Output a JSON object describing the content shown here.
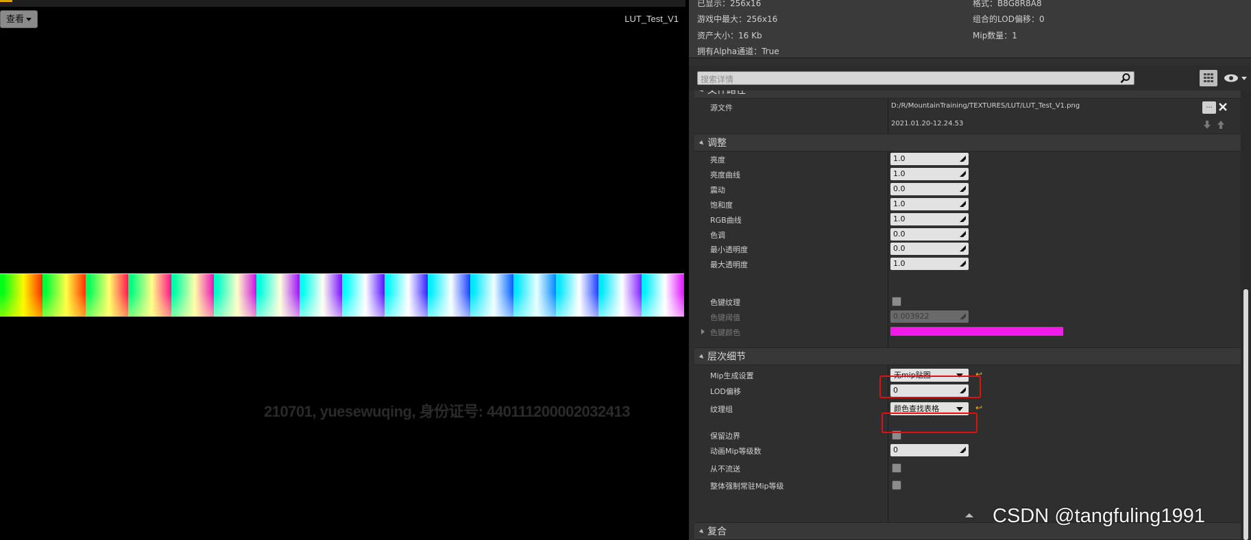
{
  "viewport": {
    "view_button": "查看",
    "asset_name": "LUT_Test_V1",
    "watermark": "210701, yuesewuqing, 身份证号: 440111200002032413",
    "lut_tiles": [
      [
        "#ff2a00",
        "#00ff18",
        "#fbf900",
        "#ff3a00"
      ],
      [
        "#ff3000",
        "#00ff38",
        "#ffff45",
        "#ff2e00"
      ],
      [
        "#ff1850",
        "#00ff5a",
        "#ffff6a",
        "#ff2060"
      ],
      [
        "#ff1088",
        "#00ff80",
        "#ffff88",
        "#ff1090"
      ],
      [
        "#ee10b8",
        "#00ffa8",
        "#ffffa8",
        "#ee10c0"
      ],
      [
        "#cc10e0",
        "#00ffc8",
        "#ffffc8",
        "#cc10e8"
      ],
      [
        "#a010f8",
        "#00ffe0",
        "#ffffdd",
        "#a010ff"
      ],
      [
        "#7810ff",
        "#00fff0",
        "#fffff0",
        "#7810ff"
      ],
      [
        "#5510ff",
        "#00ffff",
        "#ffffff",
        "#5510ff"
      ],
      [
        "#3520ff",
        "#00f8ff",
        "#ffffff",
        "#3a20ff"
      ],
      [
        "#1a40ff",
        "#00f0ff",
        "#f8ffff",
        "#2040ff"
      ],
      [
        "#0060ff",
        "#00e8ff",
        "#f0ffff",
        "#0060ff"
      ],
      [
        "#0088ff",
        "#00e8ff",
        "#e8ffff",
        "#3050ff"
      ],
      [
        "#2040ff",
        "#00e8ff",
        "#ffffff",
        "#8030ff"
      ],
      [
        "#8020ff",
        "#00e8ff",
        "#ffffff",
        "#d020ff"
      ],
      [
        "#e010ff",
        "#00f0ff",
        "#ffffff",
        "#ff10ff"
      ]
    ]
  },
  "info": {
    "displayed": "已显示：256x16",
    "format": "格式：B8G8R8A8",
    "max_ingame": "游戏中最大：256x16",
    "combined_lod": "组合的LOD偏移：0",
    "resource_size": "资产大小：16 Kb",
    "mip_count": "Mip数量：1",
    "has_alpha": "拥有Alpha通道：True"
  },
  "search": {
    "placeholder": "搜索详情"
  },
  "file_path": {
    "category": "文件路径",
    "source_label": "源文件",
    "source_value": "D:/R/MountainTraining/TEXTURES/LUT/LUT_Test_V1.png",
    "timestamp": "2021.01.20-12.24.53",
    "browse_label": "..."
  },
  "adjust": {
    "category": "调整",
    "rows": [
      {
        "label": "亮度",
        "value": "1.0"
      },
      {
        "label": "亮度曲线",
        "value": "1.0"
      },
      {
        "label": "震动",
        "value": "0.0"
      },
      {
        "label": "饱和度",
        "value": "1.0"
      },
      {
        "label": "RGB曲线",
        "value": "1.0"
      },
      {
        "label": "色调",
        "value": "0.0"
      },
      {
        "label": "最小透明度",
        "value": "0.0"
      },
      {
        "label": "最大透明度",
        "value": "1.0"
      }
    ],
    "chroma_key_label": "色键纹理",
    "chroma_threshold_label": "色键阈值",
    "chroma_threshold_value": "0.003922",
    "chroma_color_label": "色键颜色",
    "chroma_color": "#ee1bea"
  },
  "lod": {
    "category": "层次细节",
    "mip_gen_label": "Mip生成设置",
    "mip_gen_value": "无mip贴图",
    "lod_bias_label": "LOD偏移",
    "lod_bias_value": "0",
    "texture_group_label": "纹理组",
    "texture_group_value": "颜色查找表格",
    "preserve_border_label": "保留边界",
    "anim_mip_label": "动画Mip等级数",
    "anim_mip_value": "0",
    "never_stream_label": "从不流送",
    "force_resident_label": "整体强制常驻Mip等级"
  },
  "compositing": {
    "category": "复合"
  },
  "colors": {
    "highlight": "#e01010",
    "reset_arrow": "#e8b400"
  },
  "watermark_csdn": "CSDN @tangfuling1991"
}
